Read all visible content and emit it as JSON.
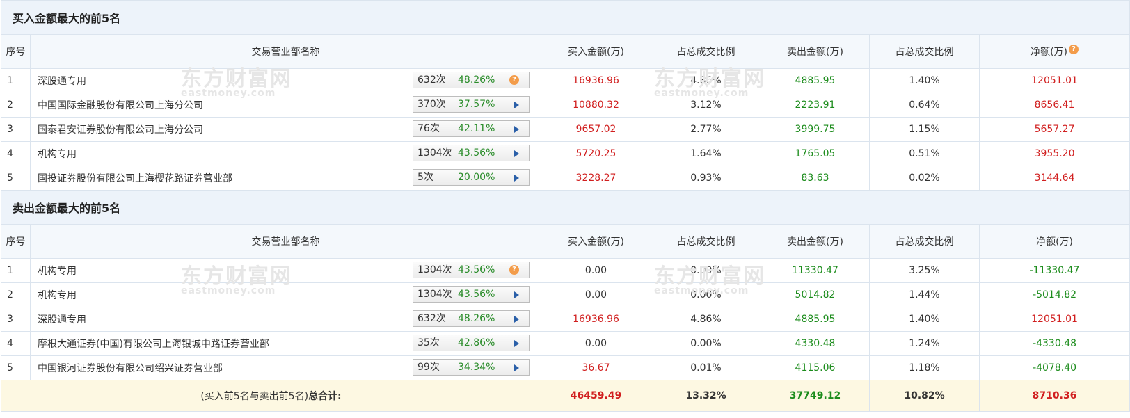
{
  "buy_section": {
    "title": "买入金额最大的前5名",
    "headers": [
      "序号",
      "交易营业部名称",
      "买入金额(万)",
      "占总成交比例",
      "卖出金额(万)",
      "占总成交比例",
      "净额(万)"
    ],
    "rows": [
      {
        "seq": "1",
        "name": "深股通专用",
        "count": "632次",
        "pct": "48.26%",
        "badge_icon": "help",
        "buy": "16936.96",
        "buy_ratio": "4.86%",
        "sell": "4885.95",
        "sell_ratio": "1.40%",
        "net": "12051.01"
      },
      {
        "seq": "2",
        "name": "中国国际金融股份有限公司上海分公司",
        "count": "370次",
        "pct": "37.57%",
        "badge_icon": "arrow",
        "buy": "10880.32",
        "buy_ratio": "3.12%",
        "sell": "2223.91",
        "sell_ratio": "0.64%",
        "net": "8656.41"
      },
      {
        "seq": "3",
        "name": "国泰君安证券股份有限公司上海分公司",
        "count": "76次",
        "pct": "42.11%",
        "badge_icon": "arrow",
        "buy": "9657.02",
        "buy_ratio": "2.77%",
        "sell": "3999.75",
        "sell_ratio": "1.15%",
        "net": "5657.27"
      },
      {
        "seq": "4",
        "name": "机构专用",
        "count": "1304次",
        "pct": "43.56%",
        "badge_icon": "arrow",
        "buy": "5720.25",
        "buy_ratio": "1.64%",
        "sell": "1765.05",
        "sell_ratio": "0.51%",
        "net": "3955.20"
      },
      {
        "seq": "5",
        "name": "国投证券股份有限公司上海樱花路证券营业部",
        "count": "5次",
        "pct": "20.00%",
        "badge_icon": "arrow",
        "buy": "3228.27",
        "buy_ratio": "0.93%",
        "sell": "83.63",
        "sell_ratio": "0.02%",
        "net": "3144.64"
      }
    ]
  },
  "sell_section": {
    "title": "卖出金额最大的前5名",
    "headers": [
      "序号",
      "交易营业部名称",
      "买入金额(万)",
      "占总成交比例",
      "卖出金额(万)",
      "占总成交比例",
      "净额(万)"
    ],
    "rows": [
      {
        "seq": "1",
        "name": "机构专用",
        "count": "1304次",
        "pct": "43.56%",
        "badge_icon": "help",
        "buy": "0.00",
        "buy_ratio": "0.00%",
        "sell": "11330.47",
        "sell_ratio": "3.25%",
        "net": "-11330.47"
      },
      {
        "seq": "2",
        "name": "机构专用",
        "count": "1304次",
        "pct": "43.56%",
        "badge_icon": "arrow",
        "buy": "0.00",
        "buy_ratio": "0.00%",
        "sell": "5014.82",
        "sell_ratio": "1.44%",
        "net": "-5014.82"
      },
      {
        "seq": "3",
        "name": "深股通专用",
        "count": "632次",
        "pct": "48.26%",
        "badge_icon": "arrow",
        "buy": "16936.96",
        "buy_ratio": "4.86%",
        "sell": "4885.95",
        "sell_ratio": "1.40%",
        "net": "12051.01"
      },
      {
        "seq": "4",
        "name": "摩根大通证券(中国)有限公司上海银城中路证券营业部",
        "count": "35次",
        "pct": "42.86%",
        "badge_icon": "arrow",
        "buy": "0.00",
        "buy_ratio": "0.00%",
        "sell": "4330.48",
        "sell_ratio": "1.24%",
        "net": "-4330.48"
      },
      {
        "seq": "5",
        "name": "中国银河证券股份有限公司绍兴证券营业部",
        "count": "99次",
        "pct": "34.34%",
        "badge_icon": "arrow",
        "buy": "36.67",
        "buy_ratio": "0.01%",
        "sell": "4115.06",
        "sell_ratio": "1.18%",
        "net": "-4078.40"
      }
    ]
  },
  "total": {
    "label": "(买入前5名与卖出前5名)",
    "label_bold": "总合计:",
    "buy": "46459.49",
    "buy_ratio": "13.32%",
    "sell": "37749.12",
    "sell_ratio": "10.82%",
    "net": "8710.36"
  },
  "watermark": {
    "cn": "东方财富网",
    "en": "eastmoney.com"
  },
  "colors": {
    "buy": "#d11f1f",
    "sell": "#1c8c1c",
    "header_bg": "#edf3fa",
    "total_bg": "#fdf8e2",
    "help_icon": "#f39c4a",
    "arrow_icon": "#2a5fa8"
  }
}
